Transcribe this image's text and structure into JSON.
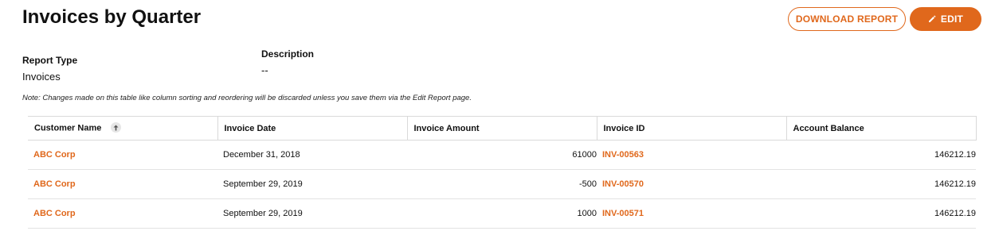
{
  "header": {
    "title": "Invoices by Quarter",
    "download_label": "DOWNLOAD REPORT",
    "edit_label": "EDIT"
  },
  "meta": {
    "report_type_label": "Report Type",
    "report_type_value": "Invoices",
    "description_label": "Description",
    "description_value": "--"
  },
  "note": "Note: Changes made on this table like column sorting and reordering will be discarded unless you save them via the Edit Report page.",
  "table": {
    "columns": [
      "Customer Name",
      "Invoice Date",
      "Invoice Amount",
      "Invoice ID",
      "Account Balance"
    ],
    "sorted_column": "Customer Name",
    "sort_direction": "ascending",
    "rows": [
      {
        "customer": "ABC Corp",
        "date": "December 31, 2018",
        "amount": "61000",
        "invoice_id": "INV-00563",
        "balance": "146212.19"
      },
      {
        "customer": "ABC Corp",
        "date": "September 29, 2019",
        "amount": "-500",
        "invoice_id": "INV-00570",
        "balance": "146212.19"
      },
      {
        "customer": "ABC Corp",
        "date": "September 29, 2019",
        "amount": "1000",
        "invoice_id": "INV-00571",
        "balance": "146212.19"
      }
    ]
  },
  "colors": {
    "accent": "#e0681c",
    "text": "#111111",
    "border": "#d9d9d9"
  },
  "icons": {
    "edit": "pencil-icon",
    "sort": "arrow-up-icon"
  }
}
